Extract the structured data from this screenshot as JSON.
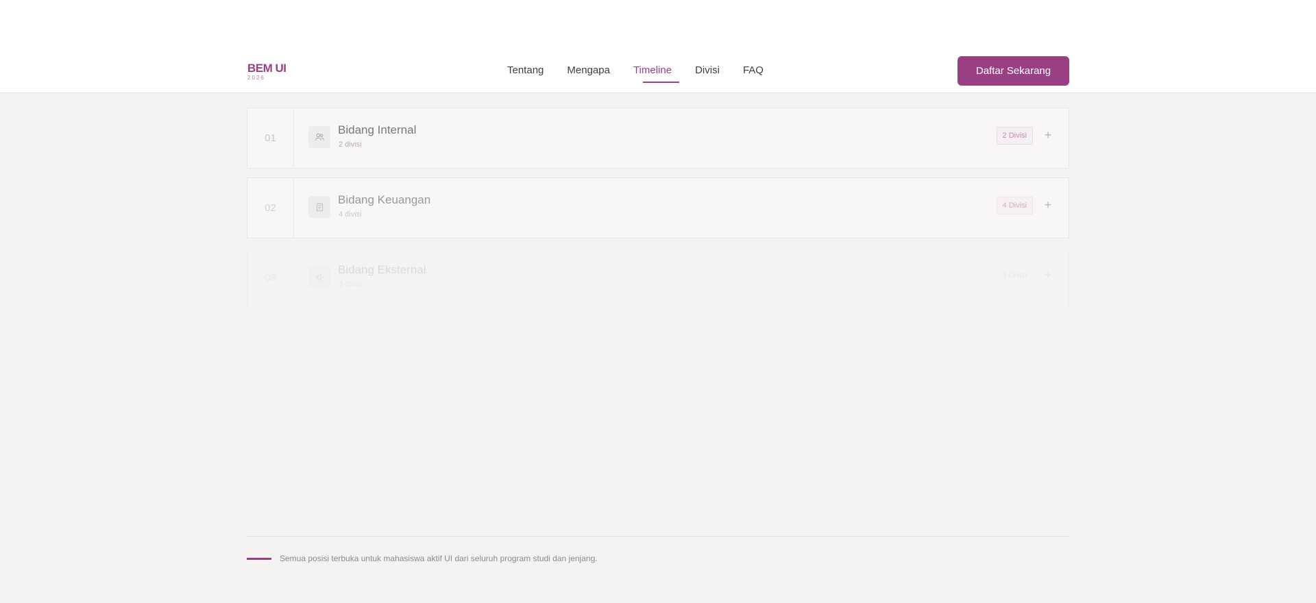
{
  "brand": {
    "name": "BEM UI",
    "year": "2026",
    "color": "#9b3f84"
  },
  "nav": {
    "items": [
      {
        "label": "Tentang"
      },
      {
        "label": "Mengapa"
      },
      {
        "label": "Timeline",
        "active": true
      },
      {
        "label": "Divisi"
      },
      {
        "label": "FAQ"
      }
    ],
    "cta_label": "Daftar Sekarang"
  },
  "accordion": {
    "rows": [
      {
        "num": "01",
        "title": "Bidang Internal",
        "subtitle": "2 divisi",
        "badge": "2 Divisi",
        "icon": "users-icon"
      },
      {
        "num": "02",
        "title": "Bidang Keuangan",
        "subtitle": "4 divisi",
        "badge": "4 Divisi",
        "icon": "document-icon"
      },
      {
        "num": "03",
        "title": "Bidang Eksternal",
        "subtitle": "3 divisi",
        "badge": "3 Divisi",
        "icon": "megaphone-icon"
      }
    ]
  },
  "footer": {
    "note": "Semua posisi terbuka untuk mahasiswa aktif UI dari seluruh program studi dan jenjang."
  }
}
